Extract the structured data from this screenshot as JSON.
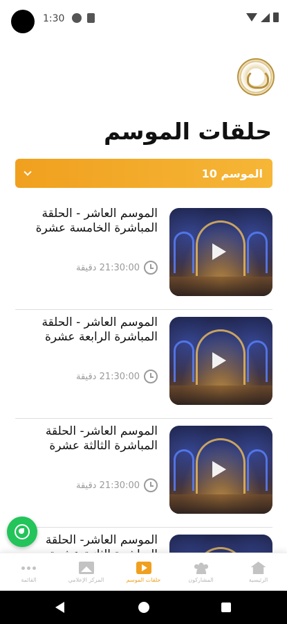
{
  "status_bar": {
    "time": "1:30"
  },
  "page": {
    "title": "حلقات الموسم"
  },
  "season_select": {
    "selected": "الموسم 10"
  },
  "episodes": [
    {
      "title": "الموسم العاشر - الحلقة المباشرة الخامسة عشرة",
      "duration": "21:30:00 دقيقة"
    },
    {
      "title": "الموسم العاشر - الحلقة المباشرة الرابعة عشرة",
      "duration": "21:30:00 دقيقة"
    },
    {
      "title": "الموسم العاشر- الحلقة المباشرة الثالثة عشرة",
      "duration": "21:30:00 دقيقة"
    },
    {
      "title": "الموسم العاشر- الحلقة المباشرة الثانية عشرة",
      "duration": ""
    }
  ],
  "bottom_nav": {
    "items": [
      {
        "label": "الرئيسية",
        "icon": "home-icon"
      },
      {
        "label": "المشاركون",
        "icon": "people-icon"
      },
      {
        "label": "حلقات الموسم",
        "icon": "video-icon",
        "active": true
      },
      {
        "label": "المركز الإعلامي",
        "icon": "image-icon"
      },
      {
        "label": "القائمة",
        "icon": "more-icon"
      }
    ]
  },
  "colors": {
    "accent": "#f0a01e",
    "whatsapp": "#23c45a"
  }
}
